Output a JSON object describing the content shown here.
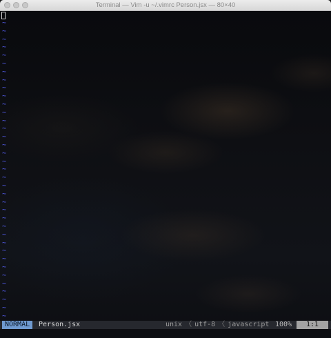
{
  "window": {
    "title": "Terminal — Vim -u ~/.vimrc Person.jsx — 80×40"
  },
  "editor": {
    "empty_line_marker": "~",
    "empty_line_count": 37
  },
  "statusline": {
    "mode": "NORMAL",
    "filename": "Person.jsx",
    "fileformat": "unix",
    "encoding": "utf-8",
    "filetype": "javascript",
    "separator": "〈",
    "percent": "100%",
    "position": "1:1"
  },
  "colors": {
    "tilde": "#5a63ff",
    "mode_bg": "#6f9ad0",
    "position_bg": "#a3a3a3"
  }
}
